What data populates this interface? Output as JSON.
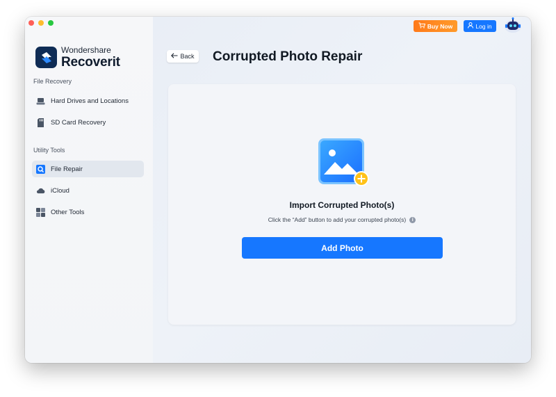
{
  "app": {
    "brand": "Wondershare",
    "product": "Recoverit"
  },
  "sidebar": {
    "sections": [
      {
        "title": "File Recovery",
        "items": [
          {
            "label": "Hard Drives and Locations",
            "icon": "hard-drive-icon"
          },
          {
            "label": "SD Card Recovery",
            "icon": "sd-card-icon"
          }
        ]
      },
      {
        "title": "Utility Tools",
        "items": [
          {
            "label": "File Repair",
            "icon": "file-repair-icon",
            "active": true
          },
          {
            "label": "iCloud",
            "icon": "cloud-icon"
          },
          {
            "label": "Other Tools",
            "icon": "grid-tools-icon"
          }
        ]
      }
    ]
  },
  "topbar": {
    "buy_label": "Buy Now",
    "login_label": "Log in"
  },
  "header": {
    "back_label": "Back",
    "title": "Corrupted Photo Repair"
  },
  "card": {
    "title": "Import Corrupted Photo(s)",
    "hint": "Click the “Add” button to add your corrupted photo(s)",
    "add_label": "Add Photo"
  },
  "colors": {
    "accent": "#1677ff",
    "buy": "#ff8a22",
    "logo_bg": "#0f2c55"
  }
}
